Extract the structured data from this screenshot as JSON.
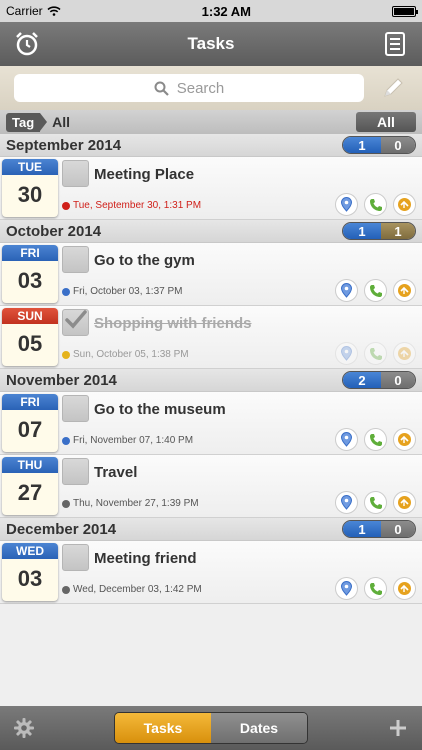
{
  "status": {
    "carrier": "Carrier",
    "time": "1:32 AM"
  },
  "nav": {
    "title": "Tasks",
    "left_icon": "alarm-clock-icon",
    "right_icon": "list-icon"
  },
  "search": {
    "placeholder": "Search"
  },
  "tag": {
    "label": "Tag",
    "value": "All",
    "filter_button": "All"
  },
  "months": [
    {
      "title": "September 2014",
      "open": "1",
      "done": "0",
      "tasks": [
        {
          "weekday": "TUE",
          "day": "30",
          "weekday_color": "blue",
          "title": "Meeting Place",
          "datetime": "Tue, September 30, 1:31 PM",
          "status": "overdue",
          "dot": "red",
          "checked": false
        }
      ]
    },
    {
      "title": "October 2014",
      "open": "1",
      "done": "1",
      "tasks": [
        {
          "weekday": "FRI",
          "day": "03",
          "weekday_color": "blue",
          "title": "Go to the gym",
          "datetime": "Fri, October 03, 1:37 PM",
          "status": "open",
          "dot": "blue",
          "checked": false
        },
        {
          "weekday": "SUN",
          "day": "05",
          "weekday_color": "red",
          "title": "Shopping with friends",
          "datetime": "Sun, October 05, 1:38 PM",
          "status": "done",
          "dot": "yellow",
          "checked": true
        }
      ]
    },
    {
      "title": "November 2014",
      "open": "2",
      "done": "0",
      "tasks": [
        {
          "weekday": "FRI",
          "day": "07",
          "weekday_color": "blue",
          "title": "Go to the museum",
          "datetime": "Fri, November 07, 1:40 PM",
          "status": "open",
          "dot": "blue",
          "checked": false
        },
        {
          "weekday": "THU",
          "day": "27",
          "weekday_color": "blue",
          "title": "Travel",
          "datetime": "Thu, November 27, 1:39 PM",
          "status": "open",
          "dot": "gray",
          "checked": false
        }
      ]
    },
    {
      "title": "December 2014",
      "open": "1",
      "done": "0",
      "tasks": [
        {
          "weekday": "WED",
          "day": "03",
          "weekday_color": "blue",
          "title": "Meeting friend",
          "datetime": "Wed, December 03, 1:42 PM",
          "status": "open",
          "dot": "gray",
          "checked": false
        }
      ]
    }
  ],
  "tabs": {
    "tasks": "Tasks",
    "dates": "Dates",
    "active": "tasks"
  },
  "colors": {
    "accent": "#e2a020",
    "overdue": "#d0201a",
    "blue": "#2a62b6"
  }
}
